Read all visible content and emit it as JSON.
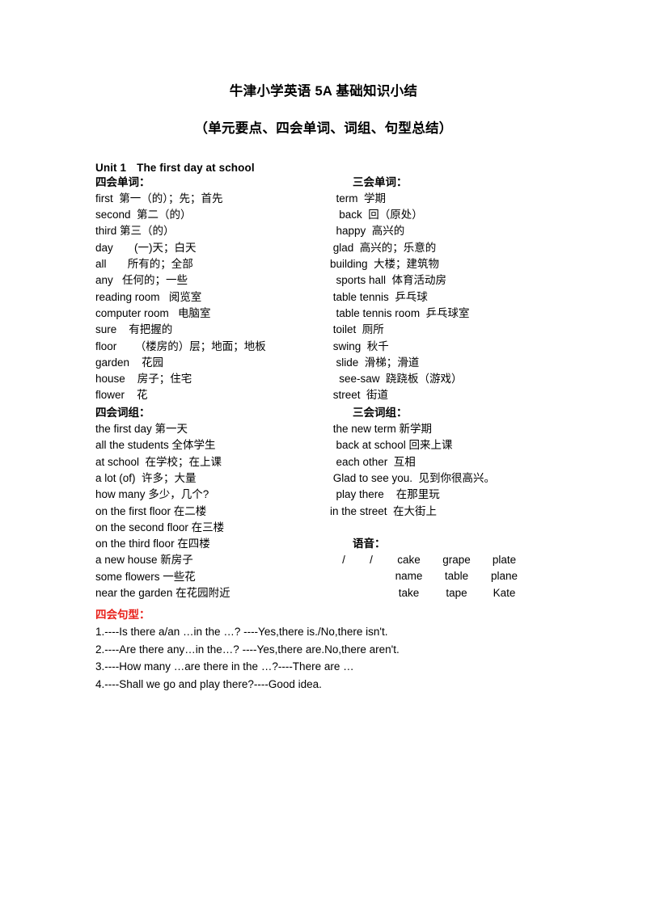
{
  "document": {
    "title": "牛津小学英语 5A 基础知识小结",
    "subtitle": "（单元要点、四会单词、词组、句型总结）"
  },
  "unit": {
    "number": "Unit 1",
    "name": "The first day at school"
  },
  "words": {
    "left_heading": "四会单词：",
    "right_heading": "三会单词：",
    "left_items": [
      "first  第一（的）；先；首先",
      "second  第二（的）",
      "third 第三（的）",
      "day       (一)天；白天",
      "all       所有的；全部",
      "any   任何的；一些",
      "reading room   阅览室",
      "computer room   电脑室",
      "sure    有把握的",
      "floor      （楼房的）层；地面；地板",
      "garden    花园",
      "house    房子；住宅",
      "flower    花"
    ],
    "right_items": [
      "  term  学期",
      "   back  回（原处）",
      "  happy  高兴的",
      " glad  高兴的；乐意的",
      "building  大楼；建筑物",
      "  sports hall  体育活动房",
      " table tennis  乒乓球",
      "  table tennis room  乒乓球室",
      " toilet  厕所",
      " swing  秋千",
      "  slide  滑梯；滑道",
      "   see-saw  跷跷板（游戏）",
      " street  街道"
    ]
  },
  "phrases": {
    "left_heading": "四会词组：",
    "right_heading": "三会词组：",
    "left_items": [
      "the first day 第一天",
      "all the students 全体学生",
      "at school  在学校；在上课",
      "a lot (of)  许多；大量",
      "how many 多少，几个?",
      "on the first floor 在二楼",
      "on the second floor 在三楼",
      "on the third floor 在四楼",
      "a new house 新房子",
      "some flowers 一些花",
      "near the garden 在花园附近"
    ],
    "right_items": [
      " the new term 新学期",
      "  back at school 回来上课",
      "  each other  互相",
      " Glad to see you.  见到你很高兴。",
      "  play there    在那里玩",
      "in the street  在大街上"
    ]
  },
  "phonetics": {
    "heading": "语音：",
    "rows": [
      [
        "/",
        "/",
        "cake",
        "grape",
        "plate"
      ],
      [
        "",
        "",
        "name",
        "table",
        "plane"
      ],
      [
        "",
        "",
        "take",
        "tape",
        "Kate"
      ]
    ]
  },
  "patterns": {
    "heading": "四会句型：",
    "color": "#e8201a",
    "items": [
      "1.----Is there a/an …in the …? ----Yes,there is./No,there isn't.",
      "2.----Are there any…in the…? ----Yes,there are.No,there aren't.",
      "3.----How many …are there in the …?----There are …",
      "4.----Shall we go and play there?----Good idea."
    ]
  }
}
